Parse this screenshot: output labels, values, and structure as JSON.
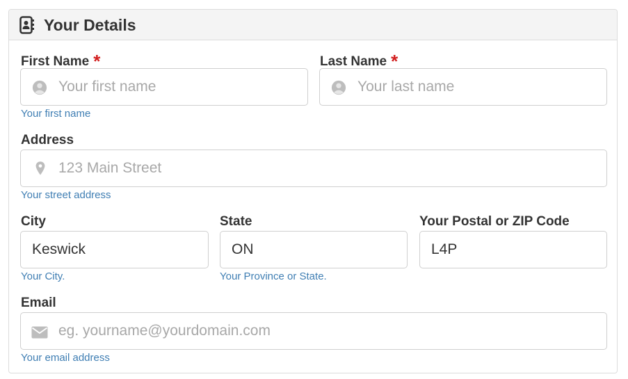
{
  "header": {
    "title": "Your Details",
    "icon": "address-card-icon"
  },
  "colors": {
    "required": "#d21f1f",
    "help": "#3f7eb3",
    "placeholder": "#a8a8a8",
    "border": "#cfcfcf"
  },
  "fields": {
    "first_name": {
      "label": "First Name",
      "required_mark": "*",
      "placeholder": "Your first name",
      "value": "",
      "help": "Your first name",
      "icon": "user-circle-icon"
    },
    "last_name": {
      "label": "Last Name",
      "required_mark": "*",
      "placeholder": "Your last name",
      "value": "",
      "icon": "user-circle-icon"
    },
    "address": {
      "label": "Address",
      "placeholder": "123 Main Street",
      "value": "",
      "help": "Your street address",
      "icon": "map-marker-icon"
    },
    "city": {
      "label": "City",
      "value": "Keswick",
      "help": "Your City."
    },
    "state": {
      "label": "State",
      "value": "ON",
      "help": "Your Province or State."
    },
    "postal": {
      "label": "Your Postal or ZIP Code",
      "value": "L4P"
    },
    "email": {
      "label": "Email",
      "placeholder": "eg. yourname@yourdomain.com",
      "value": "",
      "help": "Your email address",
      "icon": "envelope-icon"
    }
  }
}
